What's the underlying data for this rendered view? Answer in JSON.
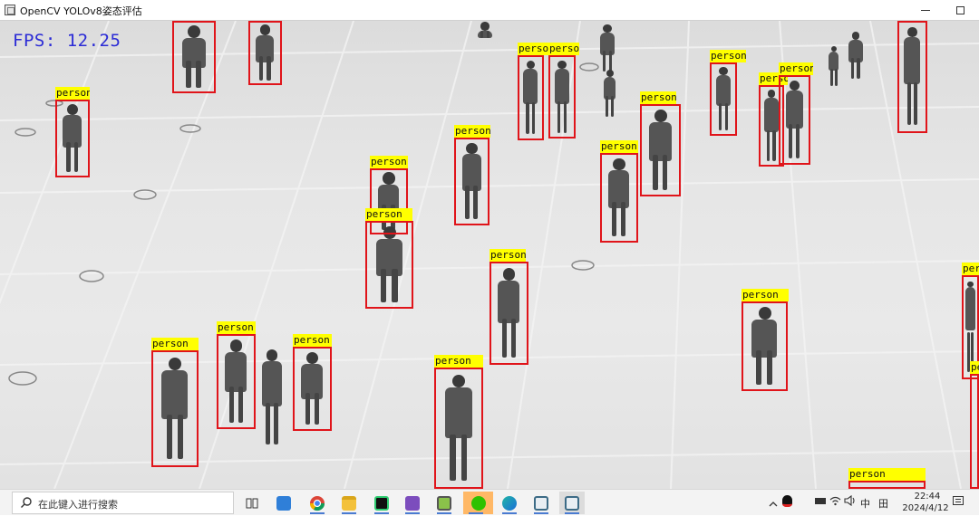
{
  "window": {
    "title": "OpenCV YOLOv8姿态评估"
  },
  "video": {
    "fps_text": "FPS: 12.25",
    "detection_label": "person",
    "colors": {
      "box": "#e0141a",
      "label_bg": "#ffff00",
      "fps": "#2b2bd6"
    }
  },
  "detections": [
    "person",
    "person",
    "person",
    "person",
    "person",
    "person",
    "person",
    "person",
    "person",
    "person",
    "person",
    "person",
    "person",
    "person",
    "person",
    "person",
    "person",
    "person",
    "person",
    "person",
    "person",
    "person",
    "person",
    "person",
    "person",
    "person",
    "person"
  ],
  "taskbar": {
    "search_placeholder": "在此键入进行搜索",
    "apps": [
      {
        "name": "task-view-icon"
      },
      {
        "name": "calendar-app-icon"
      },
      {
        "name": "chrome-icon"
      },
      {
        "name": "file-explorer-icon"
      },
      {
        "name": "pycharm-icon"
      },
      {
        "name": "visual-studio-icon"
      },
      {
        "name": "notepad-icon"
      },
      {
        "name": "wechat-icon"
      },
      {
        "name": "edge-icon"
      },
      {
        "name": "opencv-window-icon"
      },
      {
        "name": "opencv-window-icon"
      }
    ],
    "tray": {
      "input_method": "中",
      "keyboard_symbol": "田",
      "time": "22:44",
      "date": "2024/4/12"
    }
  }
}
